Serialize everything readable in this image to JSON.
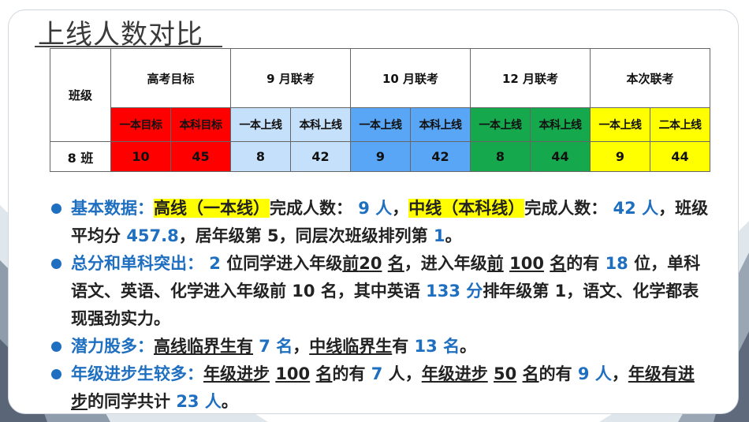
{
  "title": "上线人数对比",
  "table": {
    "class_header": "班级",
    "groups": [
      "高考目标",
      "9 月联考",
      "10 月联考",
      "12 月联考",
      "本次联考"
    ],
    "subheaders": [
      "一本目标",
      "本科目标",
      "一本上线",
      "本科上线",
      "一本上线",
      "本科上线",
      "一本上线",
      "本科上线",
      "一本上线",
      "二本上线"
    ],
    "row_label": "8 班",
    "values": [
      "10",
      "45",
      "8",
      "42",
      "9",
      "42",
      "8",
      "44",
      "9",
      "44"
    ],
    "colors": {
      "red": "#ff0000",
      "light_blue": "#c5e0fb",
      "blue": "#58a6f5",
      "green": "#16a84c",
      "yellow": "#ffff00"
    }
  },
  "bullets": {
    "b1": {
      "label": "基本数据：",
      "hl1": "高线（一本线）",
      "t1": "完成人数：",
      "v1": " 9 人",
      "t2": "，",
      "hl2": "中线（本科线）",
      "t3": "完成人数：",
      "v2": " 42 人",
      "t4": "，班级平均分 ",
      "v3": "457.8",
      "t5": "，居年级第 5，同层次班级排列第 ",
      "v4": "1",
      "t6": "。"
    },
    "b2": {
      "label": "总分和单科突出：",
      "v1": " 2 ",
      "t1": "位同学进入年级",
      "u1": "前",
      "u2": "20",
      "t2": " ",
      "u3": "名",
      "t3": "，进入年级",
      "u4": "前",
      "t4": " ",
      "u5": "100",
      "t5": " ",
      "u6": "名",
      "t6": "的有 ",
      "v2": "18",
      "t7": " 位，单科语文、英语、化学进入年级前 10 名，其中英语 ",
      "v3": "133 分",
      "t8": "排年级第 1，语文、化学都表现强劲实力。"
    },
    "b3": {
      "label": "潜力股多：",
      "u1": "高线临界生有",
      "v1": " 7 名",
      "t1": "，",
      "u2": "中线临界生",
      "t2": "有 ",
      "v2": "13 名",
      "t3": "。"
    },
    "b4": {
      "label": "年级进步生较多：",
      "u1": "年级进步",
      "t1": " ",
      "u2": "100",
      "t2": " ",
      "u3": "名",
      "t3": "的有 ",
      "v1": "7",
      "t4": " 人，",
      "u4": "年级进步",
      "t5": " ",
      "u5": "50",
      "t6": " ",
      "u6": "名",
      "t7": "的有 ",
      "v2": "9 人",
      "t8": "，",
      "u7": "年级有进步",
      "t9": "的同学共计 ",
      "v3": "23 人",
      "t10": "。"
    }
  }
}
